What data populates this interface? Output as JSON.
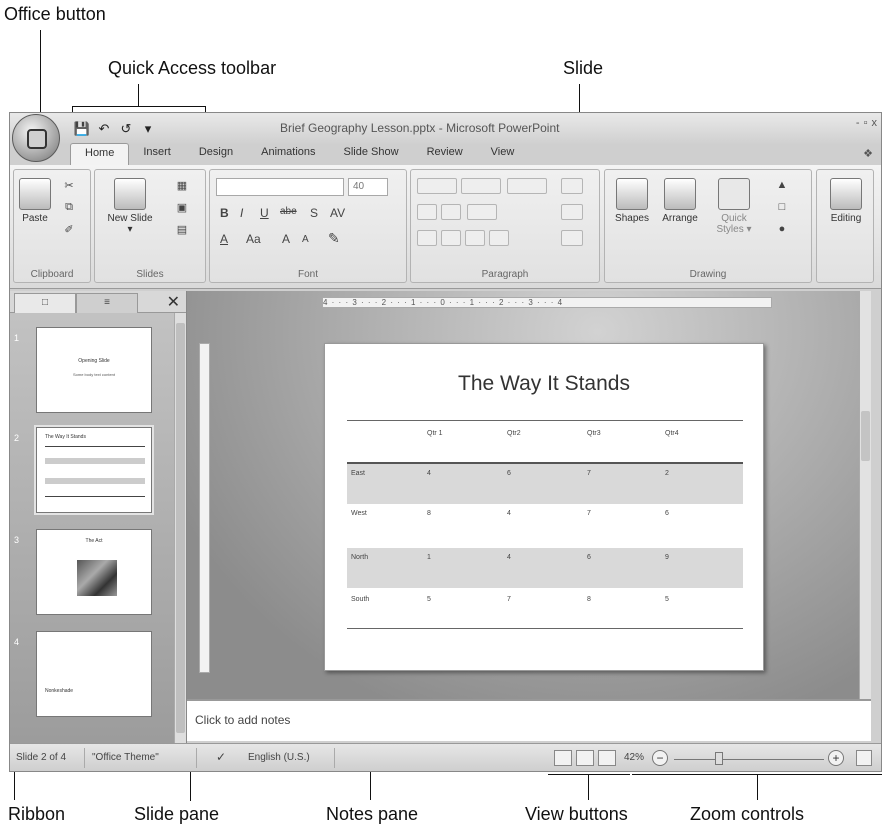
{
  "callouts": {
    "office_button": "Office button",
    "quick_access": "Quick Access toolbar",
    "slide": "Slide",
    "ribbon": "Ribbon",
    "slide_pane": "Slide pane",
    "notes_pane": "Notes pane",
    "view_buttons": "View buttons",
    "zoom_controls": "Zoom controls"
  },
  "window": {
    "title": "Brief Geography Lesson.pptx - Microsoft PowerPoint",
    "controls": [
      "-",
      "▫",
      "x"
    ]
  },
  "tabs": [
    "Home",
    "Insert",
    "Design",
    "Animations",
    "Slide Show",
    "Review",
    "View"
  ],
  "ribbon": {
    "clipboard": {
      "label": "Clipboard",
      "paste": "Paste"
    },
    "slides": {
      "label": "Slides",
      "new_slide": "New Slide ▾"
    },
    "font": {
      "label": "Font",
      "size": "40",
      "letters": [
        "B",
        "I",
        "U",
        "abe",
        "S",
        "AV",
        "A",
        "Aa",
        "A",
        "A"
      ]
    },
    "paragraph": {
      "label": "Paragraph"
    },
    "drawing": {
      "label": "Drawing",
      "shapes": "Shapes",
      "arrange": "Arrange",
      "quick_styles": "Quick Styles ▾"
    },
    "editing": {
      "label": "Editing"
    }
  },
  "slide_pane": {
    "slides": [
      {
        "num": "1",
        "title": "Opening Slide",
        "sub": "Some body text content"
      },
      {
        "num": "2",
        "title": "The Way It Stands",
        "sub": ""
      },
      {
        "num": "3",
        "title": "The Act",
        "sub": ""
      },
      {
        "num": "4",
        "title": "",
        "sub": "Nonkeshade"
      }
    ]
  },
  "slide": {
    "title": "The Way It Stands",
    "columns": [
      "",
      "Qtr 1",
      "Qtr2",
      "Qtr3",
      "Qtr4"
    ],
    "rows": [
      {
        "label": "East",
        "values": [
          "4",
          "6",
          "7",
          "2"
        ],
        "shaded": true
      },
      {
        "label": "West",
        "values": [
          "8",
          "4",
          "7",
          "6"
        ],
        "shaded": false
      },
      {
        "label": "North",
        "values": [
          "1",
          "4",
          "6",
          "9"
        ],
        "shaded": true
      },
      {
        "label": "South",
        "values": [
          "5",
          "7",
          "8",
          "5"
        ],
        "shaded": false
      }
    ]
  },
  "notes": {
    "placeholder": "Click to add notes"
  },
  "status": {
    "slide_counter": "Slide 2 of 4",
    "theme": "\"Office Theme\"",
    "language": "English (U.S.)",
    "zoom": "42%"
  },
  "ruler": {
    "text": "4 · · · 3 · · · 2 · · · 1 · · · 0 · · · 1 · · · 2 · · · 3 · · · 4"
  }
}
